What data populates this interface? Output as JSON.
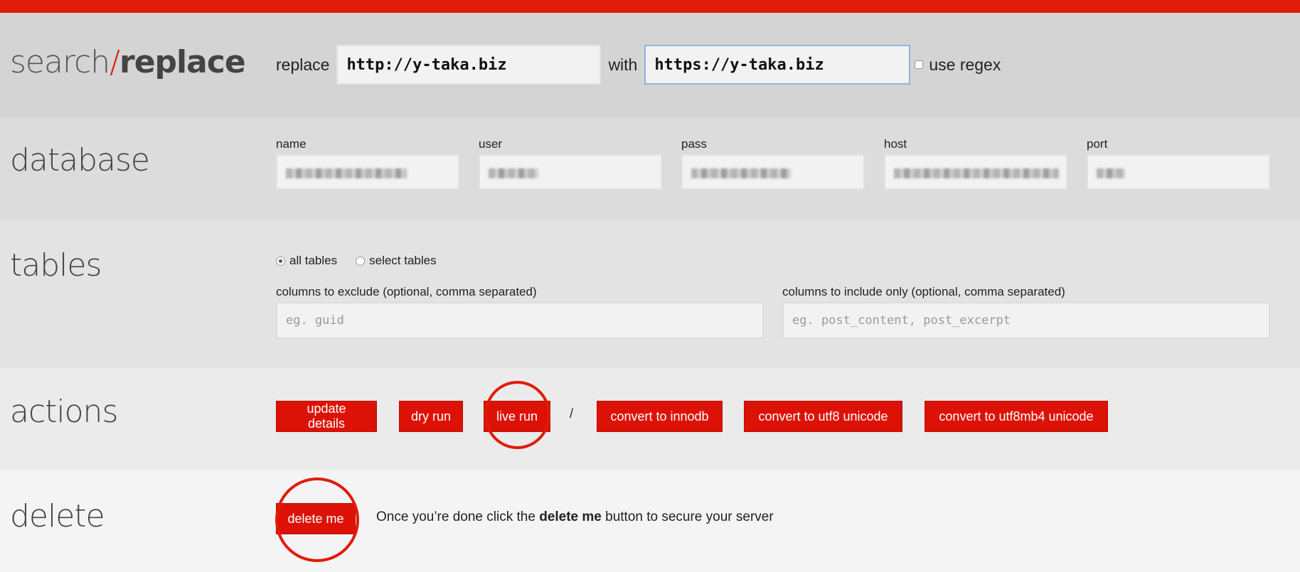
{
  "brand": {
    "part1": "search",
    "slash": "/",
    "part2": "replace"
  },
  "search": {
    "replace_label": "replace",
    "replace_value": "http://y-taka.biz",
    "with_label": "with",
    "with_value": "https://y-taka.biz",
    "regex_label": "use regex"
  },
  "database": {
    "title": "database",
    "fields": [
      {
        "label": "name"
      },
      {
        "label": "user"
      },
      {
        "label": "pass"
      },
      {
        "label": "host"
      },
      {
        "label": "port"
      }
    ]
  },
  "tables": {
    "title": "tables",
    "radio_all": "all tables",
    "radio_select": "select tables",
    "exclude_label": "columns to exclude (optional, comma separated)",
    "exclude_placeholder": "eg. guid",
    "include_label": "columns to include only (optional, comma separated)",
    "include_placeholder": "eg. post_content, post_excerpt"
  },
  "actions": {
    "title": "actions",
    "update": "update details",
    "dry_run": "dry run",
    "live_run": "live run",
    "separator": "/",
    "innodb": "convert to innodb",
    "utf8": "convert to utf8 unicode",
    "utf8mb4": "convert to utf8mb4 unicode"
  },
  "delete": {
    "title": "delete",
    "button": "delete me",
    "msg_before": "Once you’re done click the ",
    "msg_bold": "delete me",
    "msg_after": " button to secure your server"
  },
  "colors": {
    "accent": "#e01b0a",
    "button": "#dc1207"
  }
}
